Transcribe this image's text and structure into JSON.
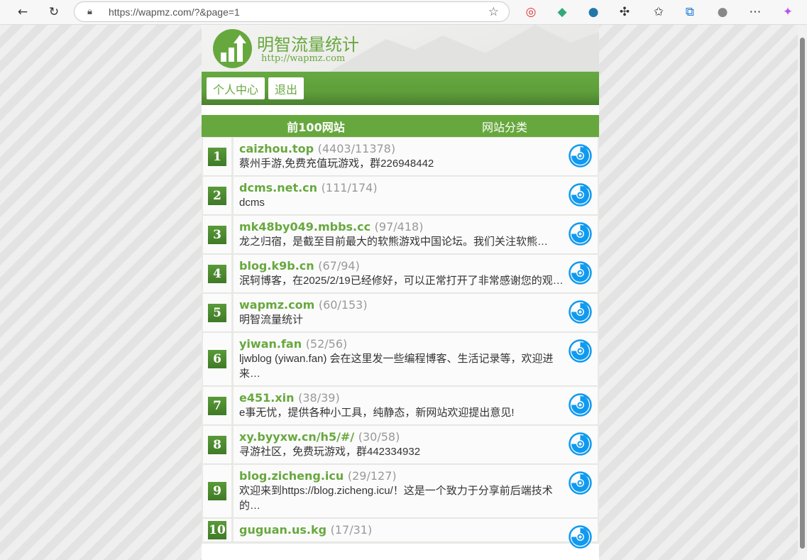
{
  "browser": {
    "url": "https://wapmz.com/?&page=1"
  },
  "header": {
    "brand": "明智流量统计",
    "brand_url": "http://wapmz.com"
  },
  "nav": {
    "profile": "个人中心",
    "logout": "退出"
  },
  "tabs": {
    "top100": "前100网站",
    "categories": "网站分类"
  },
  "colors": {
    "accent": "#67a83e",
    "icon": "#0f9af0"
  },
  "sites": [
    {
      "rank": "1",
      "name": "caizhou.top",
      "count": "(4403/11378)",
      "desc": "蔡州手游,免费充值玩游戏，群226948442"
    },
    {
      "rank": "2",
      "name": "dcms.net.cn",
      "count": "(111/174)",
      "desc": "dcms"
    },
    {
      "rank": "3",
      "name": "mk48by049.mbbs.cc",
      "count": "(97/418)",
      "desc": "龙之归宿，是截至目前最大的软熊游戏中国论坛。我们关注软熊…",
      "one": true
    },
    {
      "rank": "4",
      "name": "blog.k9b.cn",
      "count": "(67/94)",
      "desc": "泯轲博客，在2025/2/19已经修好，可以正常打开了非常感谢您的观…"
    },
    {
      "rank": "5",
      "name": "wapmz.com",
      "count": "(60/153)",
      "desc": "明智流量统计"
    },
    {
      "rank": "6",
      "name": "yiwan.fan",
      "count": "(52/56)",
      "desc": "ljwblog (yiwan.fan) 会在这里发一些编程博客、生活记录等，欢迎进来…"
    },
    {
      "rank": "7",
      "name": "e451.xin",
      "count": "(38/39)",
      "desc": "e事无忧，提供各种小工具，纯静态，新网站欢迎提出意见!"
    },
    {
      "rank": "8",
      "name": "xy.byyxw.cn/h5/#/",
      "count": "(30/58)",
      "desc": "寻游社区，免费玩游戏，群442334932"
    },
    {
      "rank": "9",
      "name": "blog.zicheng.icu",
      "count": "(29/127)",
      "desc": "欢迎来到https://blog.zicheng.icu/！这是一个致力于分享前后端技术的…"
    },
    {
      "rank": "10",
      "name": "guguan.us.kg",
      "count": "(17/31)",
      "desc": ""
    }
  ]
}
